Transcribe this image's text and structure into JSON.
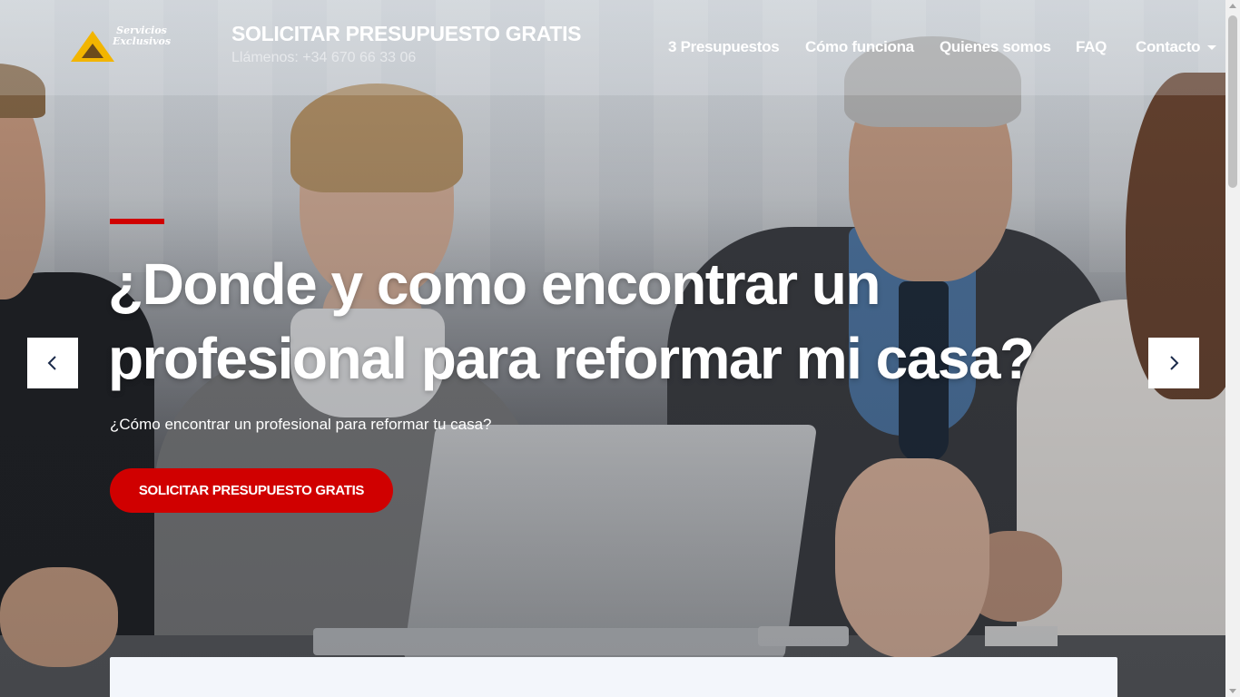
{
  "header": {
    "logo_line1": "Servicios",
    "logo_line2": "Exclusivos",
    "title": "SOLICITAR PRESUPUESTO GRATIS",
    "phone": "Llámenos: +34 670 66 33 06"
  },
  "nav": {
    "items": [
      "3 Presupuestos",
      "Cómo funciona",
      "Quienes somos",
      "FAQ",
      "Contacto"
    ]
  },
  "hero": {
    "title_line1": "¿Donde y como encontrar un",
    "title_line2": "profesional para reformar mi casa?",
    "subtitle": "¿Cómo encontrar un profesional para reformar tu casa?",
    "cta_label": "SOLICITAR PRESUPUESTO GRATIS",
    "prev_icon": "chevron-left-icon",
    "next_icon": "chevron-right-icon"
  },
  "colors": {
    "accent": "#d00000",
    "logo_yellow": "#f2b500",
    "text_on_dark": "#ffffff"
  }
}
